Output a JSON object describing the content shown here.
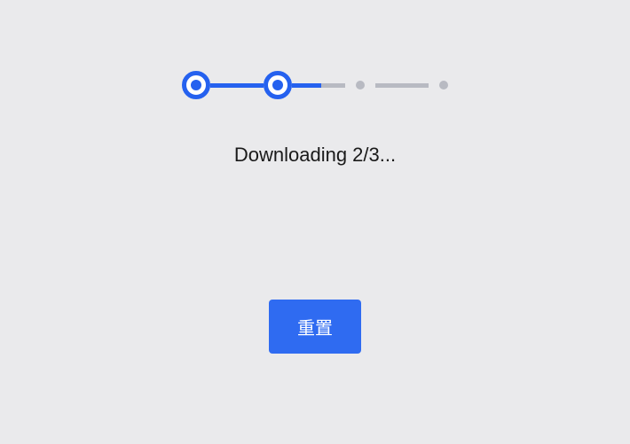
{
  "status": {
    "text": "Downloading 2/3..."
  },
  "button": {
    "reset_label": "重置"
  }
}
